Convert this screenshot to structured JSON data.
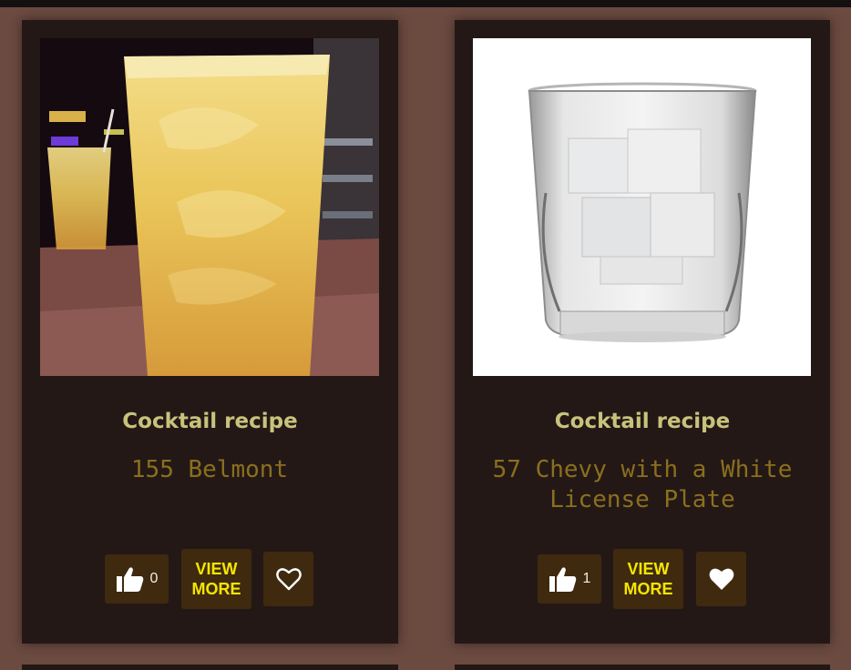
{
  "cards": [
    {
      "kicker": "Cocktail recipe",
      "name": "155 Belmont",
      "likes": "0",
      "view_line1": "VIEW",
      "view_line2": "MORE",
      "favorited": false,
      "image": "orange-cocktail-photo"
    },
    {
      "kicker": "Cocktail recipe",
      "name": "57 Chevy with a White License Plate",
      "likes": "1",
      "view_line1": "VIEW",
      "view_line2": "MORE",
      "favorited": true,
      "image": "clear-cocktail-on-ice-photo"
    }
  ],
  "colors": {
    "page_background": "#6b4a40",
    "card_background": "#231816",
    "button_background": "#3f2a0f",
    "kicker_text": "#c9c27c",
    "name_text": "#8b6f1e",
    "view_more_text": "#f6e600"
  },
  "icons": {
    "like": "thumbs-up-icon",
    "favorite_empty": "heart-outline-icon",
    "favorite_filled": "heart-filled-icon"
  }
}
